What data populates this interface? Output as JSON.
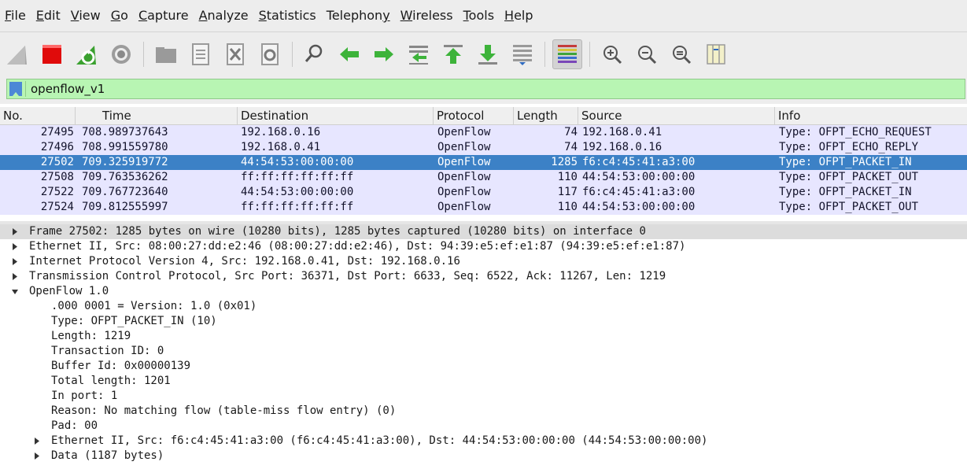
{
  "menu": [
    {
      "u": "F",
      "rest": "ile"
    },
    {
      "u": "E",
      "rest": "dit"
    },
    {
      "u": "V",
      "rest": "iew"
    },
    {
      "u": "G",
      "rest": "o"
    },
    {
      "u": "C",
      "rest": "apture"
    },
    {
      "u": "A",
      "rest": "nalyze"
    },
    {
      "u": "S",
      "rest": "tatistics"
    },
    {
      "pre": "Telephon",
      "u": "y",
      "rest": ""
    },
    {
      "u": "W",
      "rest": "ireless"
    },
    {
      "u": "T",
      "rest": "ools"
    },
    {
      "u": "H",
      "rest": "elp"
    }
  ],
  "toolbar_icons": [
    "shark-fin-icon",
    "stop-icon",
    "restart-icon",
    "options-gear-icon",
    "open-folder-icon",
    "save-file-icon",
    "close-file-icon",
    "reload-icon",
    "find-icon",
    "back-arrow-icon",
    "forward-arrow-icon",
    "go-to-packet-icon",
    "first-packet-icon",
    "last-packet-icon",
    "autoscroll-icon",
    "colorize-icon",
    "zoom-in-icon",
    "zoom-out-icon",
    "normal-size-icon",
    "resize-columns-icon"
  ],
  "filter": {
    "value": "openflow_v1"
  },
  "columns": [
    "No.",
    "Time",
    "Destination",
    "Protocol",
    "Length",
    "Source",
    "Info"
  ],
  "packets": [
    {
      "no": "27495",
      "time": "708.989737643",
      "dst": "192.168.0.16",
      "proto": "OpenFlow",
      "len": "74",
      "src": "192.168.0.41",
      "info": "Type: OFPT_ECHO_REQUEST",
      "selected": false
    },
    {
      "no": "27496",
      "time": "708.991559780",
      "dst": "192.168.0.41",
      "proto": "OpenFlow",
      "len": "74",
      "src": "192.168.0.16",
      "info": "Type: OFPT_ECHO_REPLY",
      "selected": false
    },
    {
      "no": "27502",
      "time": "709.325919772",
      "dst": "44:54:53:00:00:00",
      "proto": "OpenFlow",
      "len": "1285",
      "src": "f6:c4:45:41:a3:00",
      "info": "Type: OFPT_PACKET_IN",
      "selected": true
    },
    {
      "no": "27508",
      "time": "709.763536262",
      "dst": "ff:ff:ff:ff:ff:ff",
      "proto": "OpenFlow",
      "len": "110",
      "src": "44:54:53:00:00:00",
      "info": "Type: OFPT_PACKET_OUT",
      "selected": false
    },
    {
      "no": "27522",
      "time": "709.767723640",
      "dst": "44:54:53:00:00:00",
      "proto": "OpenFlow",
      "len": "117",
      "src": "f6:c4:45:41:a3:00",
      "info": "Type: OFPT_PACKET_IN",
      "selected": false
    },
    {
      "no": "27524",
      "time": "709.812555997",
      "dst": "ff:ff:ff:ff:ff:ff",
      "proto": "OpenFlow",
      "len": "110",
      "src": "44:54:53:00:00:00",
      "info": "Type: OFPT_PACKET_OUT",
      "selected": false
    }
  ],
  "details": [
    {
      "text": "Frame 27502: 1285 bytes on wire (10280 bits), 1285 bytes captured (10280 bits) on interface 0",
      "arrow": "right",
      "level": 0,
      "highlight": true
    },
    {
      "text": "Ethernet II, Src: 08:00:27:dd:e2:46 (08:00:27:dd:e2:46), Dst: 94:39:e5:ef:e1:87 (94:39:e5:ef:e1:87)",
      "arrow": "right",
      "level": 0
    },
    {
      "text": "Internet Protocol Version 4, Src: 192.168.0.41, Dst: 192.168.0.16",
      "arrow": "right",
      "level": 0
    },
    {
      "text": "Transmission Control Protocol, Src Port: 36371, Dst Port: 6633, Seq: 6522, Ack: 11267, Len: 1219",
      "arrow": "right",
      "level": 0
    },
    {
      "text": "OpenFlow 1.0",
      "arrow": "down",
      "level": 0
    },
    {
      "text": ".000 0001 = Version: 1.0 (0x01)",
      "arrow": "",
      "level": 1
    },
    {
      "text": "Type: OFPT_PACKET_IN (10)",
      "arrow": "",
      "level": 1
    },
    {
      "text": "Length: 1219",
      "arrow": "",
      "level": 1
    },
    {
      "text": "Transaction ID: 0",
      "arrow": "",
      "level": 1
    },
    {
      "text": "Buffer Id: 0x00000139",
      "arrow": "",
      "level": 1
    },
    {
      "text": "Total length: 1201",
      "arrow": "",
      "level": 1
    },
    {
      "text": "In port: 1",
      "arrow": "",
      "level": 1
    },
    {
      "text": "Reason: No matching flow (table-miss flow entry) (0)",
      "arrow": "",
      "level": 1
    },
    {
      "text": "Pad: 00",
      "arrow": "",
      "level": 1
    },
    {
      "text": "Ethernet II, Src: f6:c4:45:41:a3:00 (f6:c4:45:41:a3:00), Dst: 44:54:53:00:00:00 (44:54:53:00:00:00)",
      "arrow": "right",
      "level": 1
    },
    {
      "text": "Data (1187 bytes)",
      "arrow": "right",
      "level": 1
    }
  ],
  "colors": {
    "selected_row": "#3c81c6",
    "row_bg": "#e7e6ff",
    "filter_valid": "#b8f5b3"
  }
}
